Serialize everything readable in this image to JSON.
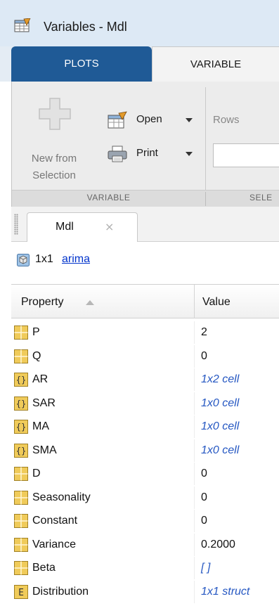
{
  "window": {
    "title": "Variables - Mdl"
  },
  "ribbon": {
    "tabs": [
      {
        "label": "PLOTS"
      },
      {
        "label": "VARIABLE"
      }
    ],
    "new_from_selection": {
      "line1": "New from",
      "line2": "Selection"
    },
    "open_label": "Open",
    "print_label": "Print",
    "rows_label": "Rows",
    "groups": [
      {
        "label": "VARIABLE"
      },
      {
        "label": "SELE"
      }
    ]
  },
  "document_tab": {
    "label": "Mdl",
    "close_glyph": "×"
  },
  "summary": {
    "dims": "1x1",
    "class_name": "arima"
  },
  "table": {
    "headers": {
      "property": "Property",
      "value": "Value"
    },
    "rows": [
      {
        "name": "P",
        "value": "2",
        "icon": "matrix-icon"
      },
      {
        "name": "Q",
        "value": "0",
        "icon": "matrix-icon"
      },
      {
        "name": "AR",
        "value": "1x2 cell",
        "icon": "cell-array-icon"
      },
      {
        "name": "SAR",
        "value": "1x0 cell",
        "icon": "cell-array-icon"
      },
      {
        "name": "MA",
        "value": "1x0 cell",
        "icon": "cell-array-icon"
      },
      {
        "name": "SMA",
        "value": "1x0 cell",
        "icon": "cell-array-icon"
      },
      {
        "name": "D",
        "value": "0",
        "icon": "matrix-icon"
      },
      {
        "name": "Seasonality",
        "value": "0",
        "icon": "matrix-icon"
      },
      {
        "name": "Constant",
        "value": "0",
        "icon": "matrix-icon"
      },
      {
        "name": "Variance",
        "value": "0.2000",
        "icon": "matrix-icon"
      },
      {
        "name": "Beta",
        "value": "[ ]",
        "icon": "matrix-icon"
      },
      {
        "name": "Distribution",
        "value": "1x1 struct",
        "icon": "struct-icon"
      }
    ]
  },
  "colors": {
    "plots_tab": "#1f5a96",
    "link": "#0033cc",
    "cell_value": "#2557c2",
    "icon_yellow": "#f0cb5a"
  }
}
